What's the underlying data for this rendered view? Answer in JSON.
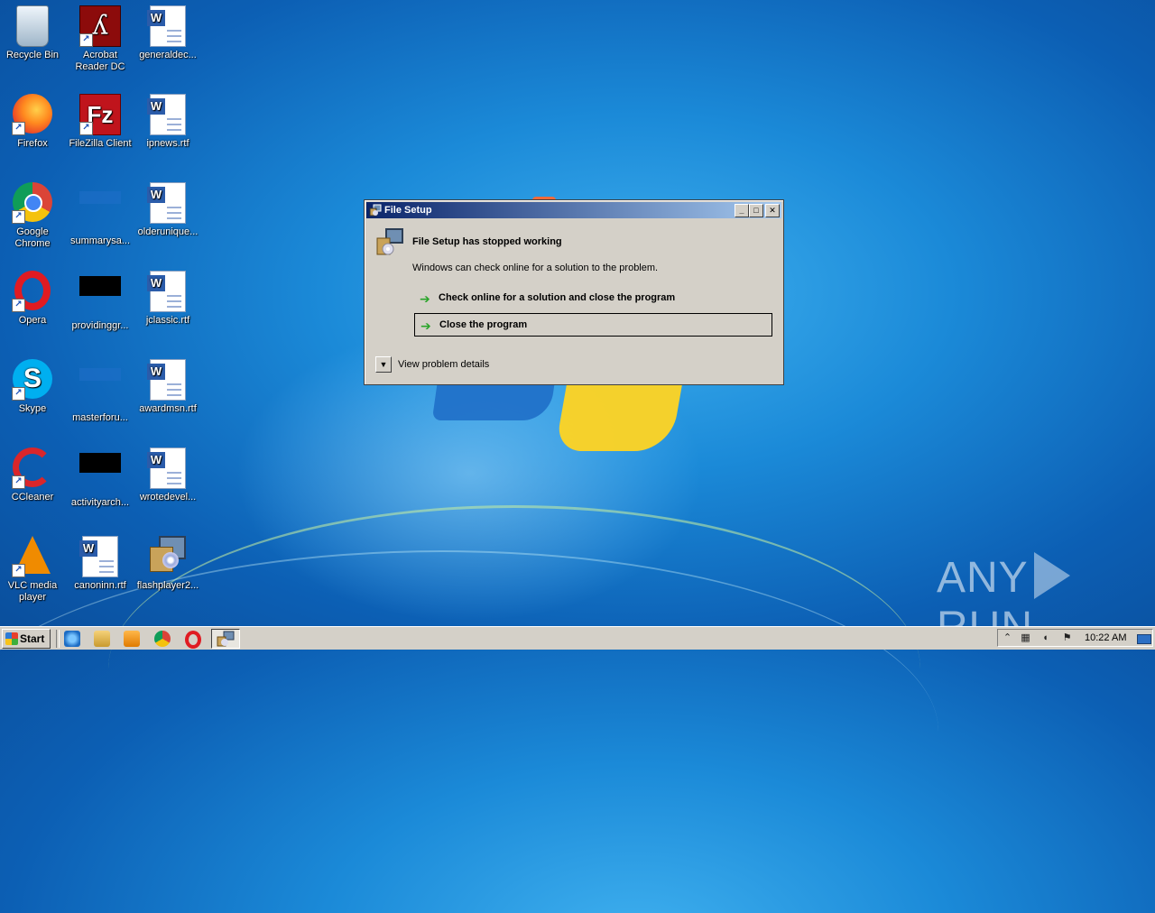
{
  "desktop": {
    "icons": [
      {
        "label": "Recycle Bin",
        "icon": "recycle-bin-icon"
      },
      {
        "label": "Acrobat Reader DC",
        "icon": "acrobat-reader-icon"
      },
      {
        "label": "generaldec...",
        "icon": "word-document-icon"
      },
      {
        "label": "Firefox",
        "icon": "firefox-icon"
      },
      {
        "label": "FileZilla Client",
        "icon": "filezilla-icon"
      },
      {
        "label": "ipnews.rtf",
        "icon": "word-document-icon"
      },
      {
        "label": "Google Chrome",
        "icon": "chrome-icon"
      },
      {
        "label": "summarysa...",
        "icon": "blank-file-icon"
      },
      {
        "label": "olderunique...",
        "icon": "word-document-icon"
      },
      {
        "label": "Opera",
        "icon": "opera-icon"
      },
      {
        "label": "providinggr...",
        "icon": "black-file-icon"
      },
      {
        "label": "jclassic.rtf",
        "icon": "word-document-icon"
      },
      {
        "label": "Skype",
        "icon": "skype-icon"
      },
      {
        "label": "masterforu...",
        "icon": "blank-file-icon"
      },
      {
        "label": "awardmsn.rtf",
        "icon": "word-document-icon"
      },
      {
        "label": "CCleaner",
        "icon": "ccleaner-icon"
      },
      {
        "label": "activityarch...",
        "icon": "black-file-icon"
      },
      {
        "label": "wrotedevel...",
        "icon": "word-document-icon"
      },
      {
        "label": "VLC media player",
        "icon": "vlc-icon"
      },
      {
        "label": "canoninn.rtf",
        "icon": "word-document-icon"
      },
      {
        "label": "flashplayer2...",
        "icon": "setup-installer-icon"
      }
    ]
  },
  "dialog": {
    "title": "File Setup",
    "heading": "File Setup has stopped working",
    "message": "Windows can check online for a solution to the problem.",
    "option_check_online": "Check online for a solution and close the program",
    "option_close": "Close the program",
    "details_label": "View problem details",
    "min_glyph": "_",
    "max_glyph": "□",
    "close_glyph": "✕"
  },
  "taskbar": {
    "start_label": "Start",
    "clock": "10:22 AM",
    "tray_chevron": "⌃"
  },
  "watermark": {
    "left": "ANY",
    "right": "RUN"
  },
  "colors": {
    "titlebar_start": "#0a246a",
    "titlebar_end": "#a6caf0",
    "dialog_bg": "#d4d0c8",
    "option_arrow": "#2aa52a"
  }
}
